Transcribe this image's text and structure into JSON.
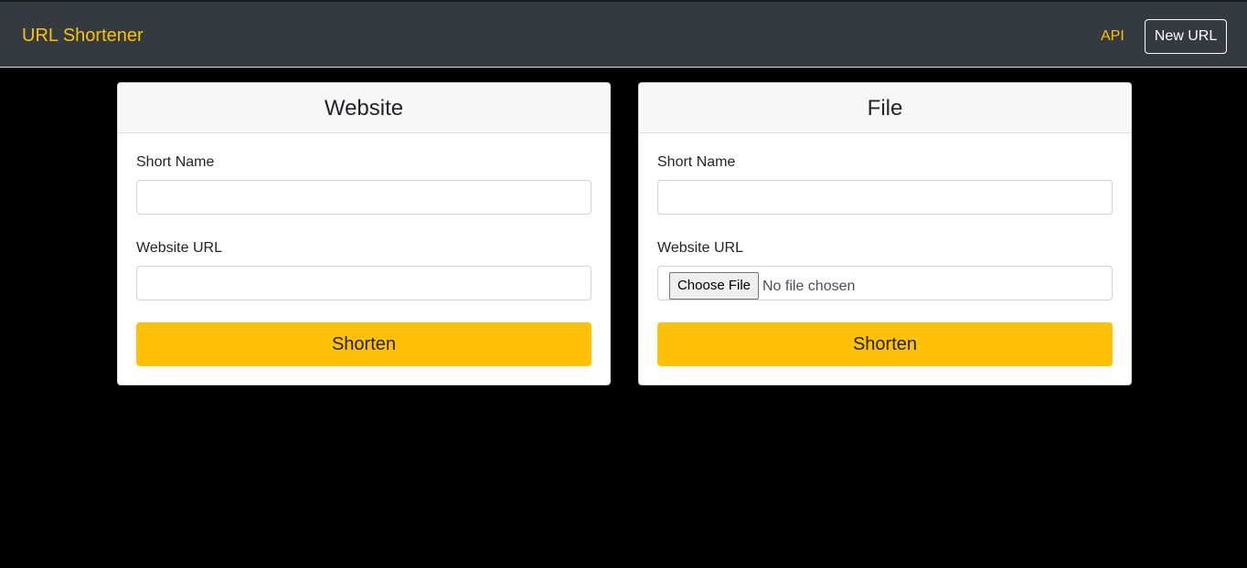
{
  "navbar": {
    "brand": "URL Shortener",
    "api_link": "API",
    "new_url_button": "New URL"
  },
  "website_card": {
    "title": "Website",
    "short_name_label": "Short Name",
    "short_name_value": "",
    "url_label": "Website URL",
    "url_value": "",
    "submit_label": "Shorten"
  },
  "file_card": {
    "title": "File",
    "short_name_label": "Short Name",
    "short_name_value": "",
    "url_label": "Website URL",
    "file_button_label": "Choose File",
    "file_status": "No file chosen",
    "submit_label": "Shorten"
  },
  "colors": {
    "accent": "#ffc107",
    "navbar_bg": "#343a40",
    "page_bg": "#000000"
  }
}
